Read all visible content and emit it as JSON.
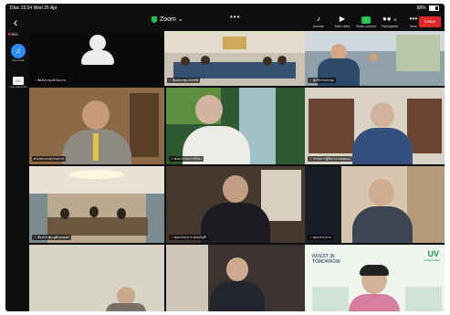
{
  "status": {
    "carrier": "Dtac",
    "time": "10:54",
    "date": "Wed 26 Apr",
    "battery_text": "68%",
    "battery_level": 0.68,
    "colors": {
      "text": "#ffffff"
    }
  },
  "topbar": {
    "back_icon": "chevron-left-icon",
    "title": "Zoom",
    "title_chevron": "⌄",
    "more_dots": "•••",
    "leave_label": "Leave",
    "leave_color": "#e02828",
    "tools": [
      {
        "icon": "speaker-icon",
        "glyph": "🔊",
        "label": "Unmute"
      },
      {
        "icon": "video-off-icon",
        "glyph": "🎥",
        "label": "Start video"
      },
      {
        "icon": "share-icon",
        "glyph": "⬆",
        "label": "Share content"
      },
      {
        "icon": "participants-icon",
        "glyph": "👥",
        "label": "Participants"
      },
      {
        "icon": "more-icon",
        "glyph": "•••",
        "label": "More"
      }
    ],
    "participants_count": "11"
  },
  "side": {
    "self_badge": "REC",
    "audio_label": "Join audio",
    "cc_label": "CC",
    "cc_sub_label": "Live transcript"
  },
  "tiles": [
    {
      "id": "self",
      "name": "ห้องประชุมสำนักงาน",
      "muted": true,
      "scene": "dark",
      "active": false
    },
    {
      "id": "room",
      "name": "ห้องประชุม UVSW",
      "muted": true,
      "scene": "conference",
      "active": false
    },
    {
      "id": "window-room",
      "name": "ผู้บริหารประชุม",
      "muted": true,
      "scene": "office",
      "active": false
    },
    {
      "id": "speaker",
      "name": "ท่านประธานกรรมการ",
      "muted": false,
      "scene": "wood",
      "active": true
    },
    {
      "id": "waterfall",
      "name": "ศ.ดร.กรรมการอิสระ",
      "muted": true,
      "scene": "nature",
      "active": false
    },
    {
      "id": "bookshelf",
      "name": "กรรมการผู้จัดการ ลอนดอน",
      "muted": true,
      "scene": "shelf",
      "active": false
    },
    {
      "id": "meeting",
      "name": "ห้องประชุม ยูนิเวนเจอร์",
      "muted": true,
      "scene": "meeting",
      "active": false
    },
    {
      "id": "cabinet",
      "name": "คุณกรรมการ สอบบัญชี",
      "muted": true,
      "scene": "cabinet",
      "active": false
    },
    {
      "id": "glasses",
      "name": "คุณกรรมการ",
      "muted": true,
      "scene": "curtain",
      "active": false
    },
    {
      "id": "bottom-left",
      "name": "",
      "muted": true,
      "scene": "plain",
      "active": false
    },
    {
      "id": "bottom-mid",
      "name": "",
      "muted": true,
      "scene": "room2",
      "active": false
    },
    {
      "id": "ad",
      "name": "",
      "muted": true,
      "scene": "ad",
      "active": false
    }
  ],
  "ad": {
    "headline_1": "INVEST IN",
    "headline_2": "TOMORROW",
    "brand": "UV",
    "brand_sub": "UNIVENTURES",
    "brand_color": "#17a34a"
  }
}
